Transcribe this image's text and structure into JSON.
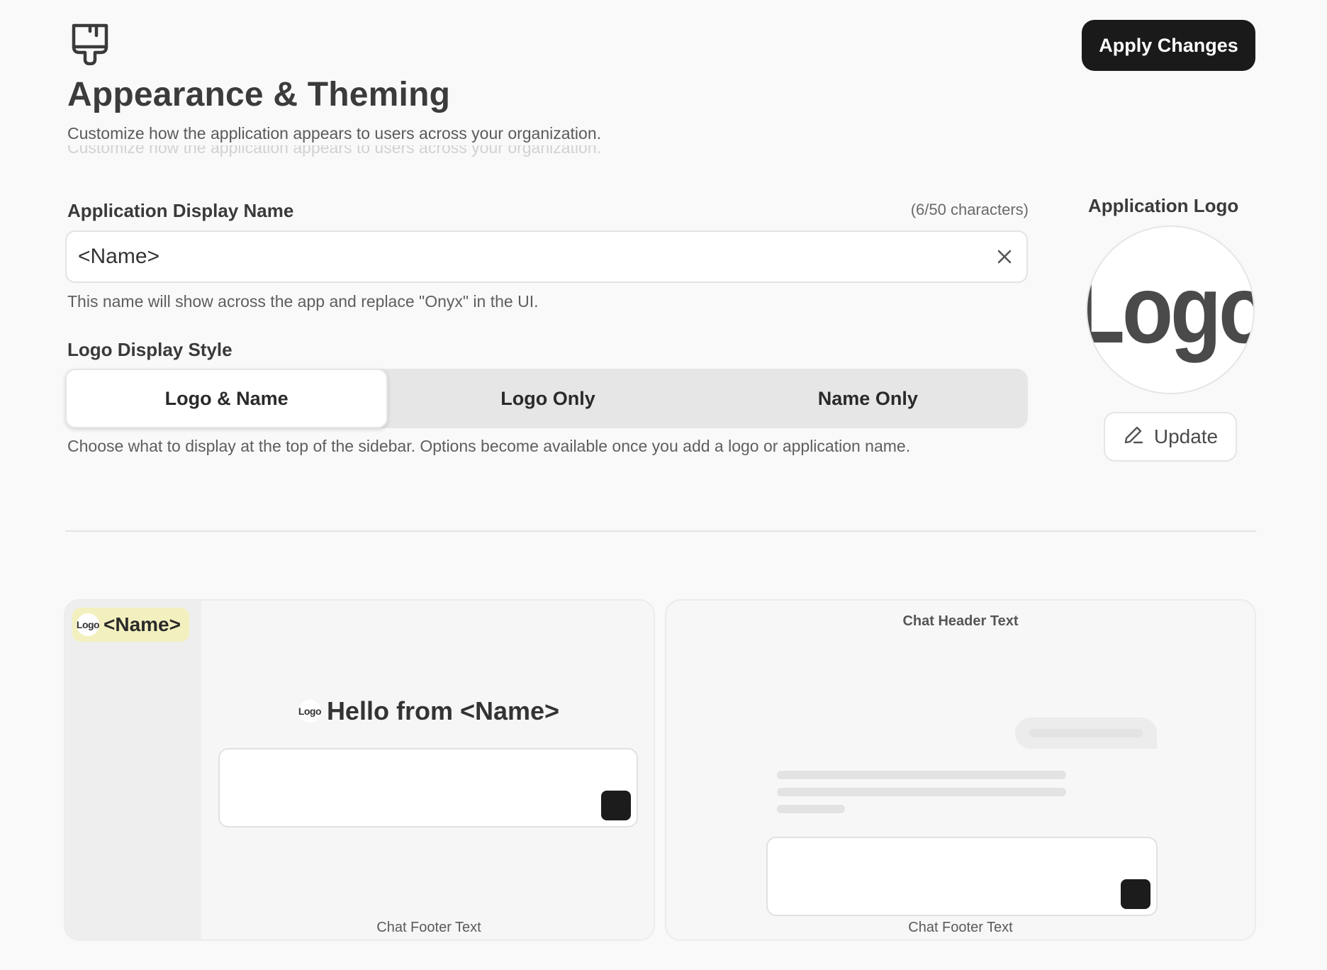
{
  "header": {
    "icon": "paintbrush-icon",
    "title": "Appearance & Theming",
    "subtitle": "Customize how the application appears to users across your organization.",
    "apply_label": "Apply Changes"
  },
  "display_name": {
    "label": "Application Display Name",
    "char_count": "(6/50 characters)",
    "value": "<Name>",
    "help": "This name will show across the app and replace \"Onyx\" in the UI."
  },
  "logo_style": {
    "label": "Logo Display Style",
    "options": [
      "Logo & Name",
      "Logo Only",
      "Name Only"
    ],
    "selected": "Logo & Name",
    "help": "Choose what to display at the top of the sidebar. Options become available once you add a logo or application name."
  },
  "logo": {
    "label": "Application Logo",
    "logo_text": "Logo",
    "update_label": "Update"
  },
  "preview_left": {
    "brand_logo": "Logo",
    "brand_name": "<Name>",
    "hello_logo": "Logo",
    "hello_text": "Hello from <Name>",
    "footer": "Chat Footer Text"
  },
  "preview_right": {
    "header": "Chat Header Text",
    "footer": "Chat Footer Text"
  },
  "colors": {
    "background": "#f9f9f9",
    "primary_button": "#1a1a1a",
    "brand_highlight": "#f3f0bf"
  }
}
